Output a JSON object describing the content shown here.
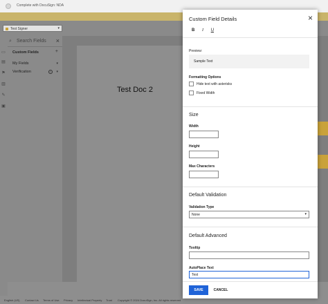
{
  "app": {
    "window_title": "Complete with DocuSign: NDA",
    "signer": "Test Signer"
  },
  "sidebar": {
    "search_placeholder": "Search Fields",
    "sections": [
      {
        "label": "Custom Fields"
      },
      {
        "label": "My Fields"
      },
      {
        "label": "Verification"
      }
    ]
  },
  "document": {
    "title": "Test Doc 2"
  },
  "footer": {
    "links": [
      "English (US)",
      "Contact Us",
      "Terms of Use",
      "Privacy",
      "Intellectual Property",
      "Trust",
      "Copyright © 2024 DocuSign, Inc. All rights reserved"
    ]
  },
  "modal": {
    "title": "Custom Field Details",
    "format_buttons": {
      "bold": "B",
      "italic": "I",
      "underline": "U"
    },
    "preview_label": "Preview:",
    "preview_text": "Sample Text",
    "formatting_options_label": "Formatting Options",
    "options": [
      {
        "label": "Hide text with asterisks",
        "checked": false
      },
      {
        "label": "Fixed Width",
        "checked": false
      }
    ],
    "size_section": "Size",
    "width_label": "Width",
    "width_value": "",
    "height_label": "Height",
    "height_value": "",
    "max_chars_label": "Max Characters",
    "max_chars_value": "",
    "validation_section": "Default Validation",
    "validation_type_label": "Validation Type",
    "validation_type_value": "None",
    "advanced_section": "Default Advanced",
    "tooltip_label": "Tooltip",
    "tooltip_value": "",
    "autoplace_label": "AutoPlace Text",
    "autoplace_value": "Test",
    "save_label": "SAVE",
    "cancel_label": "CANCEL"
  },
  "colors": {
    "primary": "#1f63d8",
    "overlay": "#8e8e8e",
    "gold": "#c9a23a"
  }
}
